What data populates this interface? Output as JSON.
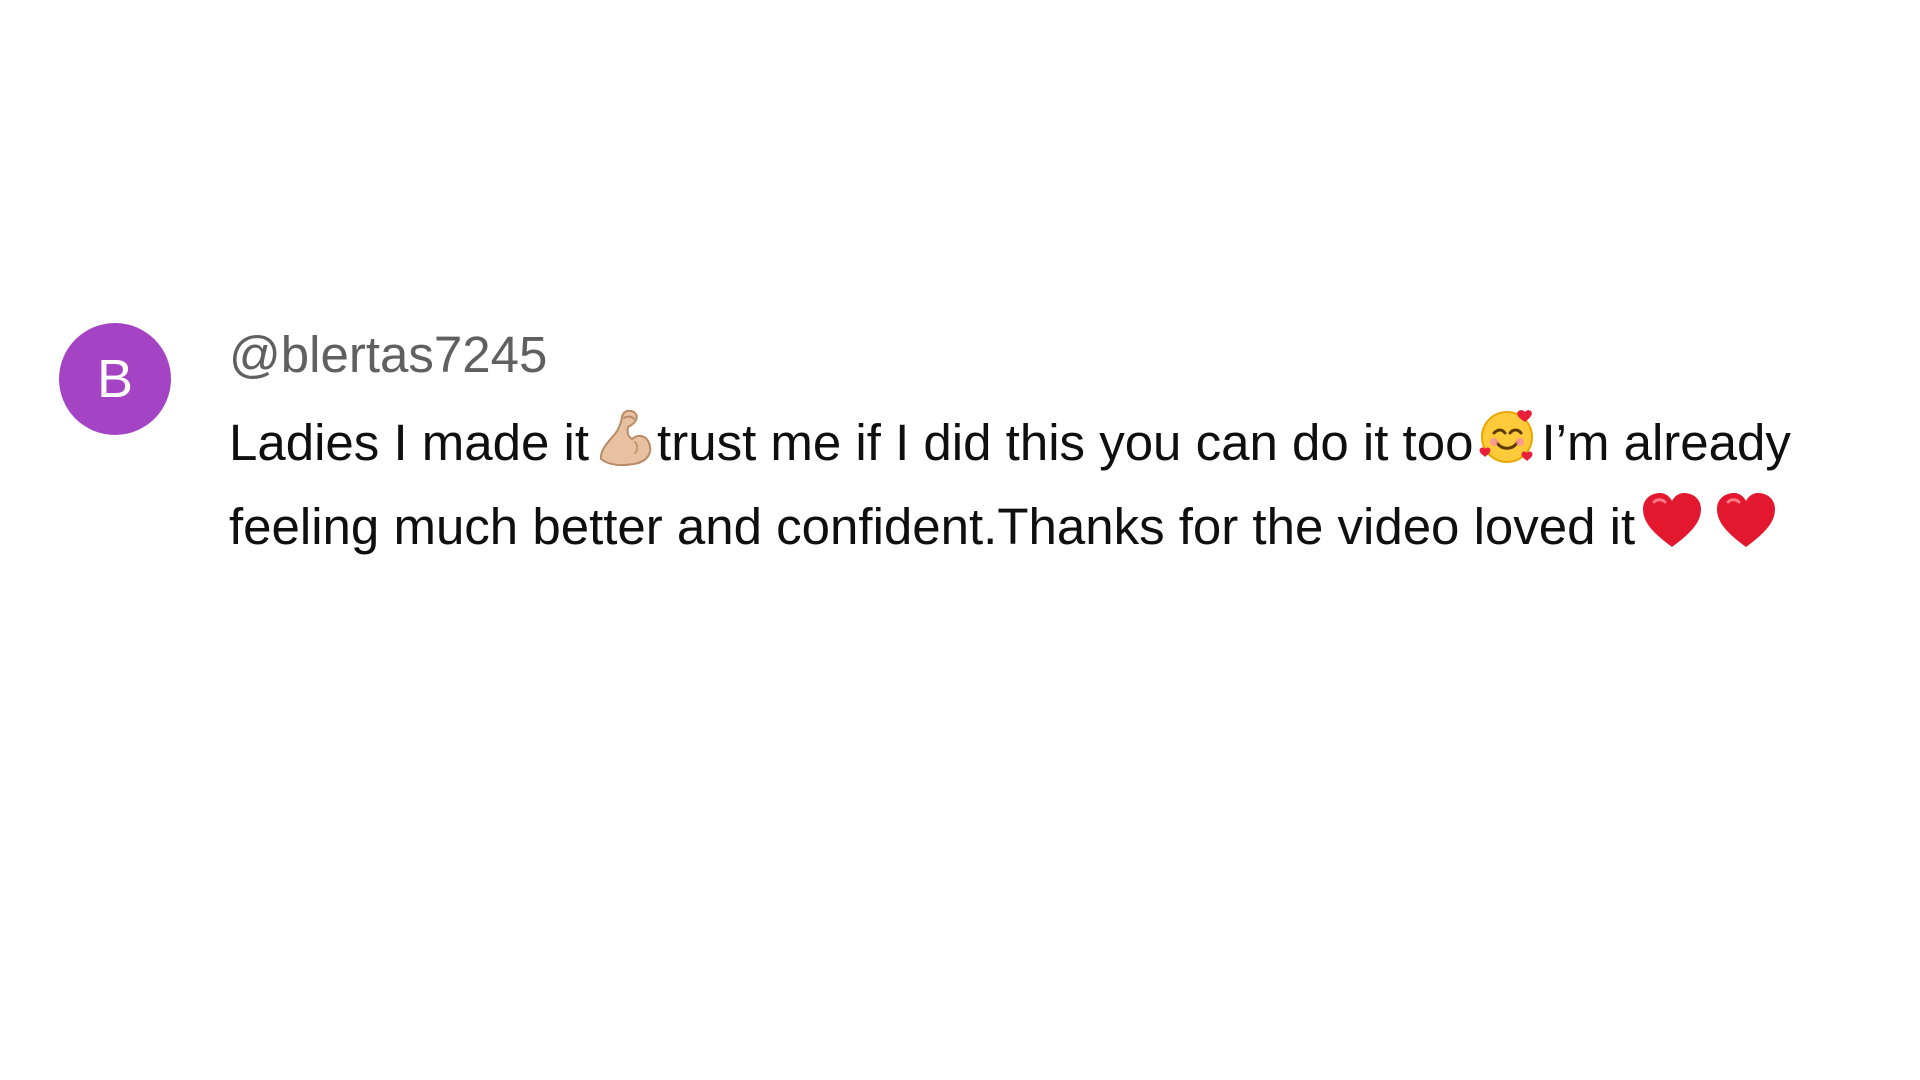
{
  "comment": {
    "avatar_letter": "B",
    "avatar_color": "#a444c4",
    "author": "@blertas7245",
    "text_parts": {
      "part1": "Ladies I made it",
      "part2": "trust me if I did this you can do it too",
      "part3": "I’m already feeling much better and confident.Thanks for the video loved it"
    },
    "emojis": [
      "flexed-biceps-icon",
      "smiling-face-with-hearts-icon",
      "red-heart-icon",
      "red-heart-icon"
    ]
  }
}
